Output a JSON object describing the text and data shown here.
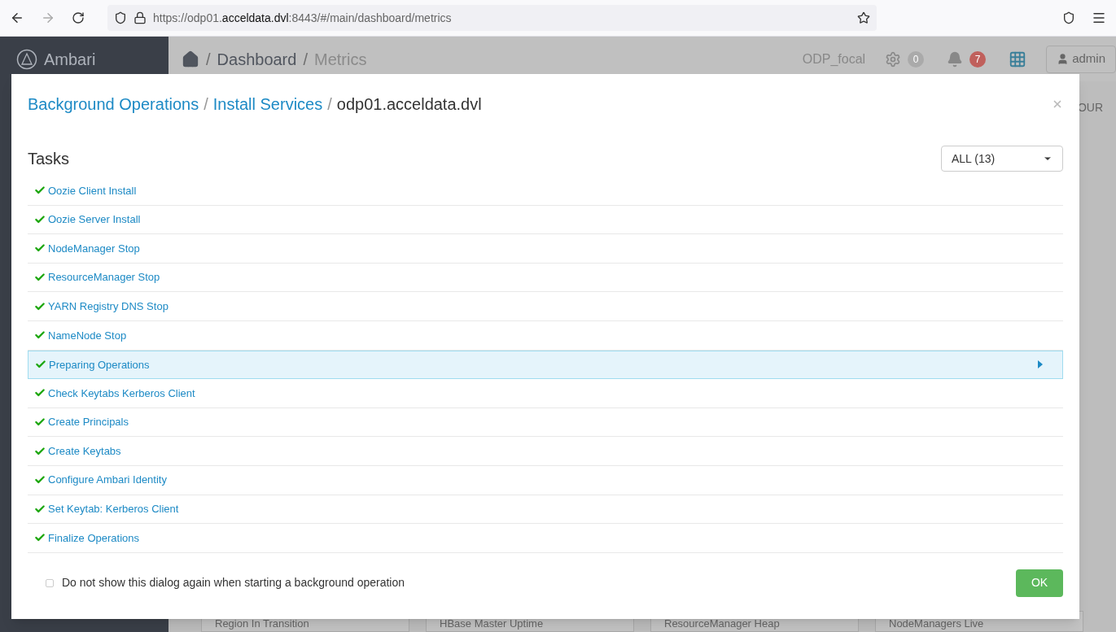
{
  "browser": {
    "url": "https://odp01.**acceldata.dvl**:8443/#/main/dashboard/metrics"
  },
  "app": {
    "brand": "Ambari",
    "separator": "/",
    "breadcrumb": [
      "Dashboard",
      "Metrics"
    ],
    "cluster": "ODP_focal",
    "ops_count": "0",
    "alerts_count": "7",
    "user": "admin",
    "partial_tab": "OUR",
    "widgets": [
      "Region In Transition",
      "HBase Master Uptime",
      "ResourceManager Heap",
      "NodeManagers Live"
    ]
  },
  "modal": {
    "separator": "/",
    "breadcrumb": [
      "Background Operations",
      "Install Services",
      "odp01.acceldata.dvl"
    ],
    "section_title": "Tasks",
    "filter": "ALL (13)",
    "tasks": [
      {
        "name": "Oozie Client Install",
        "completed": true,
        "selected": false
      },
      {
        "name": "Oozie Server Install",
        "completed": true,
        "selected": false
      },
      {
        "name": "NodeManager Stop",
        "completed": true,
        "selected": false
      },
      {
        "name": "ResourceManager Stop",
        "completed": true,
        "selected": false
      },
      {
        "name": "YARN Registry DNS Stop",
        "completed": true,
        "selected": false
      },
      {
        "name": "NameNode Stop",
        "completed": true,
        "selected": false
      },
      {
        "name": "Preparing Operations",
        "completed": true,
        "selected": true
      },
      {
        "name": "Check Keytabs Kerberos Client",
        "completed": true,
        "selected": false
      },
      {
        "name": "Create Principals",
        "completed": true,
        "selected": false
      },
      {
        "name": "Create Keytabs",
        "completed": true,
        "selected": false
      },
      {
        "name": "Configure Ambari Identity",
        "completed": true,
        "selected": false
      },
      {
        "name": "Set Keytab: Kerberos Client",
        "completed": true,
        "selected": false
      },
      {
        "name": "Finalize Operations",
        "completed": true,
        "selected": false
      }
    ],
    "dont_show": {
      "label": "Do not show this dialog again when starting a background operation",
      "checked": false
    },
    "ok": "OK"
  }
}
